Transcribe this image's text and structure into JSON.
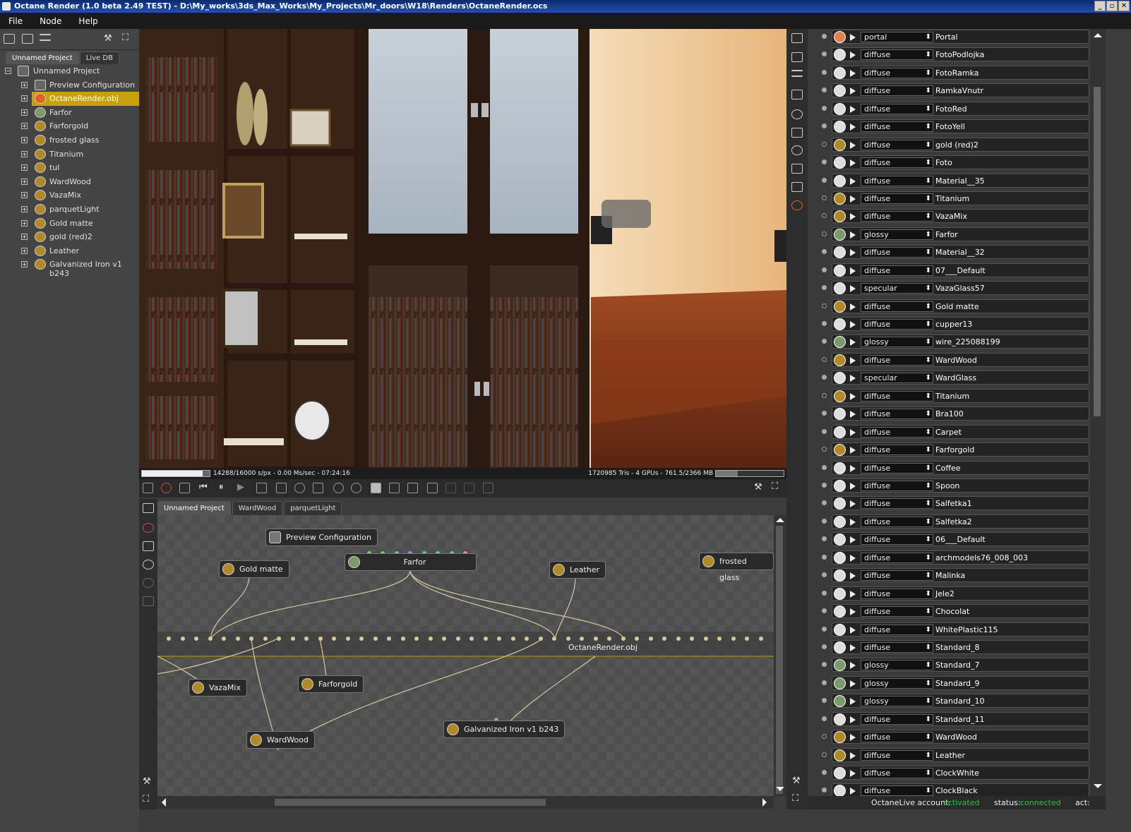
{
  "window": {
    "title": "Octane Render (1.0 beta 2.49 TEST) - D:\\My_works\\3ds_Max_Works\\My_Projects\\Mr_doors\\W18\\Renders\\OctaneRender.ocs",
    "buttons": [
      "_",
      "▫",
      "✕"
    ]
  },
  "menu": [
    "File",
    "Node",
    "Help"
  ],
  "left_panel": {
    "tabs": [
      "Unnamed Project",
      "Live DB"
    ],
    "active_tab": 0,
    "tree": [
      {
        "label": "Unnamed Project",
        "type": "root"
      },
      {
        "label": "Preview Configuration",
        "type": "config"
      },
      {
        "label": "OctaneRender.obj",
        "type": "mesh",
        "selected": true
      },
      {
        "label": "Farfor",
        "type": "material"
      },
      {
        "label": "Farforgold",
        "type": "material"
      },
      {
        "label": "frosted glass",
        "type": "material"
      },
      {
        "label": "Titanium",
        "type": "material"
      },
      {
        "label": "tul",
        "type": "material"
      },
      {
        "label": "WardWood",
        "type": "material"
      },
      {
        "label": "VazaMix",
        "type": "material"
      },
      {
        "label": "parquetLight",
        "type": "material"
      },
      {
        "label": "Gold matte",
        "type": "material"
      },
      {
        "label": "gold (red)2",
        "type": "material"
      },
      {
        "label": "Leather",
        "type": "material"
      },
      {
        "label": "Galvanized Iron v1 b243",
        "type": "material"
      }
    ]
  },
  "render_status": {
    "progress": 0.893,
    "left_text": "14288/16000 s/px - 0.00 Ms/sec - 07:24:16",
    "right_text": "1720985 Tris - 4 GPUs - 761.5/2366 MB",
    "memory_fraction": 0.322
  },
  "node_editor": {
    "tabs": [
      "Unnamed Project",
      "WardWood",
      "parquetLight"
    ],
    "active_tab": 0,
    "nodes": {
      "preview": "Preview Configuration",
      "gold_matte": "Gold matte",
      "farfor": "Farfor",
      "leather": "Leather",
      "frosted": "frosted glass",
      "obj": "OctaneRender.obj",
      "vazamix": "VazaMix",
      "farforgold": "Farforgold",
      "wardwood": "WardWood",
      "galvanized": "Galvanized Iron v1 b243"
    }
  },
  "materials": [
    {
      "type": "portal",
      "name": "Portal",
      "icon": "orange",
      "dot": "solid"
    },
    {
      "type": "diffuse",
      "name": "FotoPodlojka",
      "icon": "white",
      "dot": "solid"
    },
    {
      "type": "diffuse",
      "name": "FotoRamka",
      "icon": "white",
      "dot": "solid"
    },
    {
      "type": "diffuse",
      "name": "RamkaVnutr",
      "icon": "white",
      "dot": "solid"
    },
    {
      "type": "diffuse",
      "name": "FotoRed",
      "icon": "white",
      "dot": "solid"
    },
    {
      "type": "diffuse",
      "name": "FotoYell",
      "icon": "white",
      "dot": "solid"
    },
    {
      "type": "diffuse",
      "name": "gold (red)2",
      "icon": "yellow",
      "dot": "hollow"
    },
    {
      "type": "diffuse",
      "name": "Foto",
      "icon": "white",
      "dot": "solid"
    },
    {
      "type": "diffuse",
      "name": "Material__35",
      "icon": "white",
      "dot": "solid"
    },
    {
      "type": "diffuse",
      "name": "Titanium",
      "icon": "yellow",
      "dot": "hollow"
    },
    {
      "type": "diffuse",
      "name": "VazaMix",
      "icon": "yellow",
      "dot": "hollow"
    },
    {
      "type": "glossy",
      "name": "Farfor",
      "icon": "green",
      "dot": "hollow"
    },
    {
      "type": "diffuse",
      "name": "Material__32",
      "icon": "white",
      "dot": "solid"
    },
    {
      "type": "diffuse",
      "name": "07___Default",
      "icon": "white",
      "dot": "solid"
    },
    {
      "type": "specular",
      "name": "VazaGlass57",
      "icon": "white",
      "dot": "solid"
    },
    {
      "type": "diffuse",
      "name": "Gold matte",
      "icon": "yellow",
      "dot": "hollow"
    },
    {
      "type": "diffuse",
      "name": "cupper13",
      "icon": "white",
      "dot": "solid"
    },
    {
      "type": "glossy",
      "name": "wire_225088199",
      "icon": "green",
      "dot": "solid"
    },
    {
      "type": "diffuse",
      "name": "WardWood",
      "icon": "yellow",
      "dot": "hollow"
    },
    {
      "type": "specular",
      "name": "WardGlass",
      "icon": "white",
      "dot": "solid"
    },
    {
      "type": "diffuse",
      "name": "Titanium",
      "icon": "yellow",
      "dot": "hollow"
    },
    {
      "type": "diffuse",
      "name": "Bra100",
      "icon": "white",
      "dot": "solid"
    },
    {
      "type": "diffuse",
      "name": "Carpet",
      "icon": "white",
      "dot": "solid"
    },
    {
      "type": "diffuse",
      "name": "Farforgold",
      "icon": "yellow",
      "dot": "hollow"
    },
    {
      "type": "diffuse",
      "name": "Coffee",
      "icon": "white",
      "dot": "solid"
    },
    {
      "type": "diffuse",
      "name": "Spoon",
      "icon": "white",
      "dot": "solid"
    },
    {
      "type": "diffuse",
      "name": "Salfetka1",
      "icon": "white",
      "dot": "solid"
    },
    {
      "type": "diffuse",
      "name": "Salfetka2",
      "icon": "white",
      "dot": "solid"
    },
    {
      "type": "diffuse",
      "name": "06___Default",
      "icon": "white",
      "dot": "solid"
    },
    {
      "type": "diffuse",
      "name": "archmodels76_008_003",
      "icon": "white",
      "dot": "solid"
    },
    {
      "type": "diffuse",
      "name": "Malinka",
      "icon": "white",
      "dot": "solid"
    },
    {
      "type": "diffuse",
      "name": "Jele2",
      "icon": "white",
      "dot": "solid"
    },
    {
      "type": "diffuse",
      "name": "Chocolat",
      "icon": "white",
      "dot": "solid"
    },
    {
      "type": "diffuse",
      "name": "WhitePlastic115",
      "icon": "white",
      "dot": "solid"
    },
    {
      "type": "diffuse",
      "name": "Standard_8",
      "icon": "white",
      "dot": "solid"
    },
    {
      "type": "glossy",
      "name": "Standard_7",
      "icon": "green",
      "dot": "solid"
    },
    {
      "type": "glossy",
      "name": "Standard_9",
      "icon": "green",
      "dot": "solid"
    },
    {
      "type": "glossy",
      "name": "Standard_10",
      "icon": "green",
      "dot": "solid"
    },
    {
      "type": "diffuse",
      "name": "Standard_11",
      "icon": "white",
      "dot": "solid"
    },
    {
      "type": "diffuse",
      "name": "WardWood",
      "icon": "yellow",
      "dot": "hollow"
    },
    {
      "type": "diffuse",
      "name": "Leather",
      "icon": "yellow",
      "dot": "hollow"
    },
    {
      "type": "diffuse",
      "name": "ClockWhite",
      "icon": "white",
      "dot": "solid"
    },
    {
      "type": "diffuse",
      "name": "ClockBlack",
      "icon": "white",
      "dot": "solid"
    }
  ],
  "status_bar": {
    "account_label": "OctaneLive account:",
    "account_value": "activated",
    "status_label": "status:",
    "status_value": "connected",
    "act_label": "act:"
  }
}
